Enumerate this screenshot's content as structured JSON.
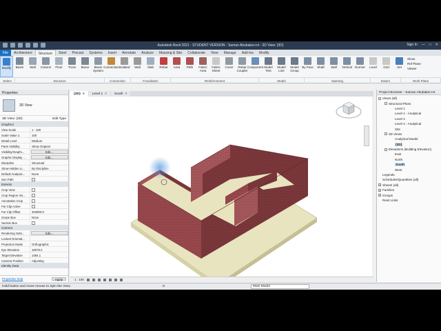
{
  "titlebar": {
    "title": "Autodesk Revit 2021 - STUDENT VERSION - Saman Abubaker.rvt - 3D View: {3D}",
    "sign_in": "Sign In"
  },
  "ribbon_tabs": [
    "File",
    "Architecture",
    "Structure",
    "Steel",
    "Precast",
    "Systems",
    "Insert",
    "Annotate",
    "Analyze",
    "Massing & Site",
    "Collaborate",
    "View",
    "Manage",
    "Add-Ins",
    "Modify"
  ],
  "active_tab": "Structure",
  "tools": [
    {
      "label": "Modify",
      "icon": "cursor-icon",
      "color": "#3a7fd0"
    },
    {
      "label": "Beam",
      "icon": "beam-icon",
      "color": "#7a8a9a"
    },
    {
      "label": "Wall",
      "icon": "wall-icon",
      "color": "#9aa6b2"
    },
    {
      "label": "Column",
      "icon": "column-icon",
      "color": "#8a96a2"
    },
    {
      "label": "Floor",
      "icon": "floor-icon",
      "color": "#a8b4c0"
    },
    {
      "label": "Truss",
      "icon": "truss-icon",
      "color": "#7c8894"
    },
    {
      "label": "Brace",
      "icon": "brace-icon",
      "color": "#7c8894"
    },
    {
      "label": "Beam System",
      "icon": "beam-system-icon",
      "color": "#8d99a5"
    },
    {
      "label": "Connection",
      "icon": "connection-icon",
      "color": "#c08a3a"
    },
    {
      "label": "Isolated",
      "icon": "isolated-footing-icon",
      "color": "#9a9a9a"
    },
    {
      "label": "Wall",
      "icon": "wall-footing-icon",
      "color": "#9a9a9a"
    },
    {
      "label": "Slab",
      "icon": "slab-icon",
      "color": "#9fb0c2"
    },
    {
      "label": "Rebar",
      "icon": "rebar-icon",
      "color": "#c04040"
    },
    {
      "label": "Area",
      "icon": "area-rebar-icon",
      "color": "#b05050"
    },
    {
      "label": "Path",
      "icon": "path-rebar-icon",
      "color": "#b05050"
    },
    {
      "label": "Fabric Area",
      "icon": "fabric-area-icon",
      "color": "#a06060"
    },
    {
      "label": "Fabric Sheet",
      "icon": "fabric-sheet-icon",
      "color": "#c8c8c8"
    },
    {
      "label": "Cover",
      "icon": "cover-icon",
      "color": "#909aa4"
    },
    {
      "label": "Rebar Coupler",
      "icon": "coupler-icon",
      "color": "#909aa4"
    },
    {
      "label": "Component",
      "icon": "component-icon",
      "color": "#6a8fb8"
    },
    {
      "label": "Model Text",
      "icon": "model-text-icon",
      "color": "#6a7a8a"
    },
    {
      "label": "Model Line",
      "icon": "model-line-icon",
      "color": "#6a7a8a"
    },
    {
      "label": "Model Group",
      "icon": "model-group-icon",
      "color": "#6a7a8a"
    },
    {
      "label": "By Face",
      "icon": "by-face-icon",
      "color": "#7d8fa3"
    },
    {
      "label": "Shaft",
      "icon": "shaft-icon",
      "color": "#7d8fa3"
    },
    {
      "label": "Wall",
      "icon": "wall-opening-icon",
      "color": "#7d8fa3"
    },
    {
      "label": "Vertical",
      "icon": "vertical-icon",
      "color": "#7d8fa3"
    },
    {
      "label": "Dormer",
      "icon": "dormer-icon",
      "color": "#7d8fa3"
    },
    {
      "label": "Level",
      "icon": "level-icon",
      "color": "#c8c8c8"
    },
    {
      "label": "Grid",
      "icon": "grid-icon",
      "color": "#c8c8c8"
    },
    {
      "label": "Set",
      "icon": "set-icon",
      "color": "#4a7fb8"
    }
  ],
  "workplane_extra": [
    "Show",
    "Ref Plane",
    "Viewer"
  ],
  "panels": [
    {
      "label": "Select",
      "w": 22
    },
    {
      "label": "Structure",
      "w": 130
    },
    {
      "label": "Connection",
      "w": 38
    },
    {
      "label": "Foundation",
      "w": 58
    },
    {
      "label": "Reinforcement",
      "w": 128
    },
    {
      "label": "Model",
      "w": 66
    },
    {
      "label": "Opening",
      "w": 96
    },
    {
      "label": "Datum",
      "w": 44
    },
    {
      "label": "Work Plane",
      "w": 58
    }
  ],
  "select_label": "Select",
  "properties": {
    "title": "Properties",
    "type_name": "3D View",
    "filter": "3D View: {3D}",
    "edit_type": "Edit Type",
    "sections": [
      {
        "name": "Graphics",
        "rows": [
          {
            "k": "View Scale",
            "v": "1 : 100"
          },
          {
            "k": "Scale Value 1:",
            "v": "100"
          },
          {
            "k": "Detail Level",
            "v": "Medium"
          },
          {
            "k": "Parts Visibility",
            "v": "Show Original"
          },
          {
            "k": "Visibility/Graphi...",
            "v": "Edit...",
            "btn": true
          },
          {
            "k": "Graphic Display ...",
            "v": "Edit...",
            "btn": true
          },
          {
            "k": "Discipline",
            "v": "Structural"
          },
          {
            "k": "Show Hidden Li...",
            "v": "By Discipline"
          },
          {
            "k": "Default Analysis...",
            "v": "None"
          },
          {
            "k": "Sun Path",
            "v": "",
            "chk": true
          }
        ]
      },
      {
        "name": "Extents",
        "rows": [
          {
            "k": "Crop View",
            "v": "",
            "chk": true
          },
          {
            "k": "Crop Region Vis...",
            "v": "",
            "chk": true
          },
          {
            "k": "Annotation Crop",
            "v": "",
            "chk": true
          },
          {
            "k": "Far Clip Active",
            "v": "",
            "chk": true
          },
          {
            "k": "Far Clip Offset",
            "v": "304800.0"
          },
          {
            "k": "Scope Box",
            "v": "None"
          },
          {
            "k": "Section Box",
            "v": "",
            "chk": true
          }
        ]
      },
      {
        "name": "Camera",
        "rows": [
          {
            "k": "Rendering Setti...",
            "v": "Edit...",
            "btn": true
          },
          {
            "k": "Locked Orientat...",
            "v": ""
          },
          {
            "k": "Projection Mode",
            "v": "Orthographic"
          },
          {
            "k": "Eye Elevation",
            "v": "18078.2"
          },
          {
            "k": "Target Elevation",
            "v": "1484.1"
          },
          {
            "k": "Camera Position",
            "v": "Adjusting"
          }
        ]
      },
      {
        "name": "Identity Data",
        "rows": []
      }
    ],
    "help": "Properties help",
    "apply": "Apply"
  },
  "view_tabs": [
    {
      "label": "{3D}",
      "active": true
    },
    {
      "label": "Level 1",
      "active": false
    },
    {
      "label": "South",
      "active": false
    }
  ],
  "view_scale": "1 : 100",
  "project_browser": {
    "title": "Project Browser - Saman Abubaker.rvt",
    "nodes": [
      {
        "t": "Views (all)",
        "lvl": 0,
        "tg": "-"
      },
      {
        "t": "Structural Plans",
        "lvl": 1,
        "tg": "-"
      },
      {
        "t": "Level 1",
        "lvl": 2
      },
      {
        "t": "Level 1 - Analytical",
        "lvl": 2
      },
      {
        "t": "Level 2",
        "lvl": 2
      },
      {
        "t": "Level 2 - Analytical",
        "lvl": 2
      },
      {
        "t": "Site",
        "lvl": 2
      },
      {
        "t": "3D Views",
        "lvl": 1,
        "tg": "-"
      },
      {
        "t": "Analytical Model",
        "lvl": 2
      },
      {
        "t": "{3D}",
        "lvl": 2,
        "sel": true
      },
      {
        "t": "Elevations (Building Elevation)",
        "lvl": 1,
        "tg": "-"
      },
      {
        "t": "East",
        "lvl": 2
      },
      {
        "t": "North",
        "lvl": 2
      },
      {
        "t": "South",
        "lvl": 2,
        "sel": true
      },
      {
        "t": "West",
        "lvl": 2
      },
      {
        "t": "Legends",
        "lvl": 0
      },
      {
        "t": "Schedules/Quantities (all)",
        "lvl": 0
      },
      {
        "t": "Sheets (all)",
        "lvl": 0,
        "tg": "+"
      },
      {
        "t": "Families",
        "lvl": 0,
        "tg": "+"
      },
      {
        "t": "Groups",
        "lvl": 0,
        "tg": "+"
      },
      {
        "t": "Revit Links",
        "lvl": 0
      }
    ]
  },
  "viewcube_label": "FRONT",
  "status": {
    "message": "Hold button and move mouse to Spin the View.",
    "model": "Main Model",
    "zero": ":0"
  },
  "colors": {
    "brick": "#9a4a4e",
    "brick_dark": "#7a3438",
    "brick_light": "#b56368",
    "slab": "#e8e4c0",
    "accent": "#1e6fc0"
  }
}
